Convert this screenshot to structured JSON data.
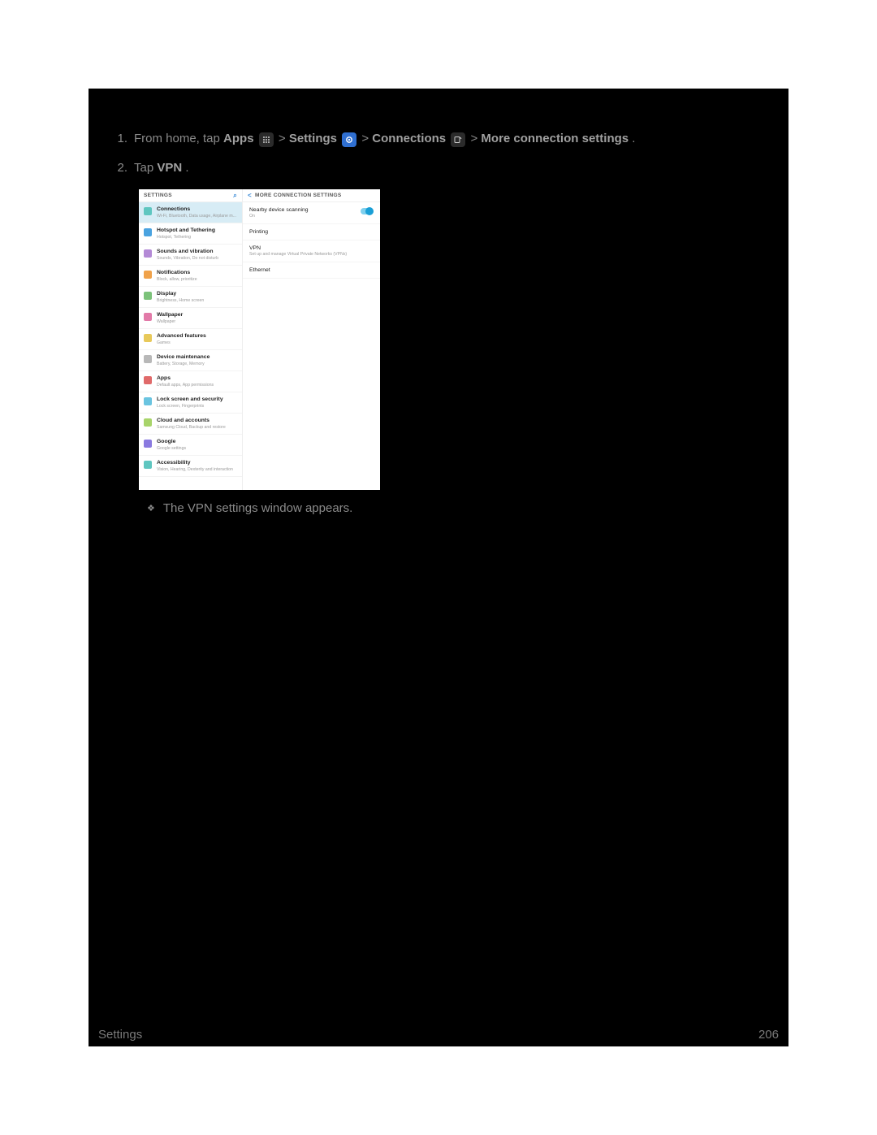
{
  "steps": {
    "s1_num": "1.",
    "s1_a": "From home, tap ",
    "s1_apps": "Apps",
    "s1_gt1": " > ",
    "s1_settings": "Settings",
    "s1_gt2": " > ",
    "s1_connections": "Connections",
    "s1_gt3": " > ",
    "s1_more": "More connection settings",
    "s1_end": ".",
    "s2_num": "2.",
    "s2_a": "Tap ",
    "s2_vpn": "VPN",
    "s2_end": "."
  },
  "result": "The VPN settings window appears.",
  "footer": {
    "section": "Settings",
    "page": "206"
  },
  "screenshot": {
    "left_header": "SETTINGS",
    "right_header": "MORE CONNECTION SETTINGS",
    "menu": [
      {
        "title": "Connections",
        "sub": "Wi-Fi, Bluetooth, Data usage, Airplane m...",
        "color": "c-teal",
        "selected": true
      },
      {
        "title": "Hotspot and Tethering",
        "sub": "Hotspot, Tethering",
        "color": "c-blue"
      },
      {
        "title": "Sounds and vibration",
        "sub": "Sounds, Vibration, Do not disturb",
        "color": "c-purple"
      },
      {
        "title": "Notifications",
        "sub": "Block, allow, prioritize",
        "color": "c-orange"
      },
      {
        "title": "Display",
        "sub": "Brightness, Home screen",
        "color": "c-green"
      },
      {
        "title": "Wallpaper",
        "sub": "Wallpaper",
        "color": "c-pink"
      },
      {
        "title": "Advanced features",
        "sub": "Games",
        "color": "c-yellow"
      },
      {
        "title": "Device maintenance",
        "sub": "Battery, Storage, Memory",
        "color": "c-gray"
      },
      {
        "title": "Apps",
        "sub": "Default apps, App permissions",
        "color": "c-red"
      },
      {
        "title": "Lock screen and security",
        "sub": "Lock screen, Fingerprints",
        "color": "c-cyan"
      },
      {
        "title": "Cloud and accounts",
        "sub": "Samsung Cloud, Backup and restore",
        "color": "c-lime"
      },
      {
        "title": "Google",
        "sub": "Google settings",
        "color": "c-violet"
      },
      {
        "title": "Accessibility",
        "sub": "Vision, Hearing, Dexterity and interaction",
        "color": "c-teal"
      }
    ],
    "right": [
      {
        "title": "Nearby device scanning",
        "sub": "On",
        "toggle": true
      },
      {
        "title": "Printing",
        "sub": ""
      },
      {
        "title": "VPN",
        "sub": "Set up and manage Virtual Private Networks (VPNs)"
      },
      {
        "title": "Ethernet",
        "sub": ""
      }
    ]
  }
}
